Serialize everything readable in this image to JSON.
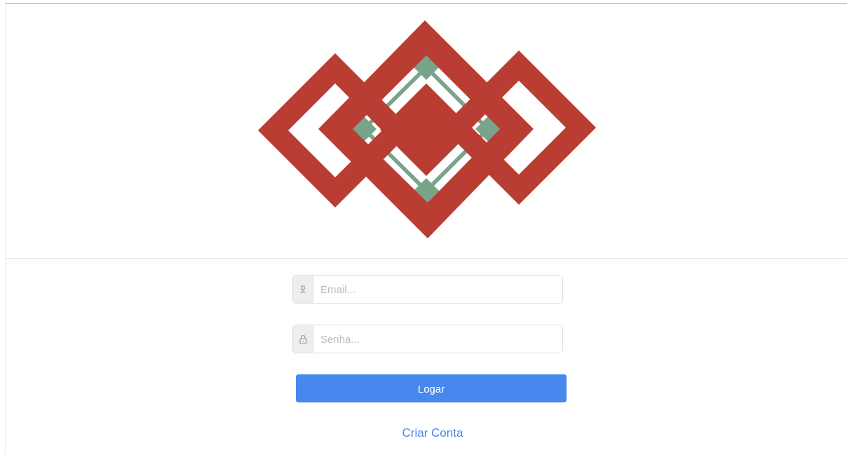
{
  "fields": [
    {
      "kind": "email",
      "placeholder": "Email..."
    },
    {
      "kind": "password",
      "placeholder": "Senha..."
    }
  ],
  "login_button": {
    "label": "Logar"
  },
  "create_account_link": {
    "label": "Criar Conta"
  }
}
